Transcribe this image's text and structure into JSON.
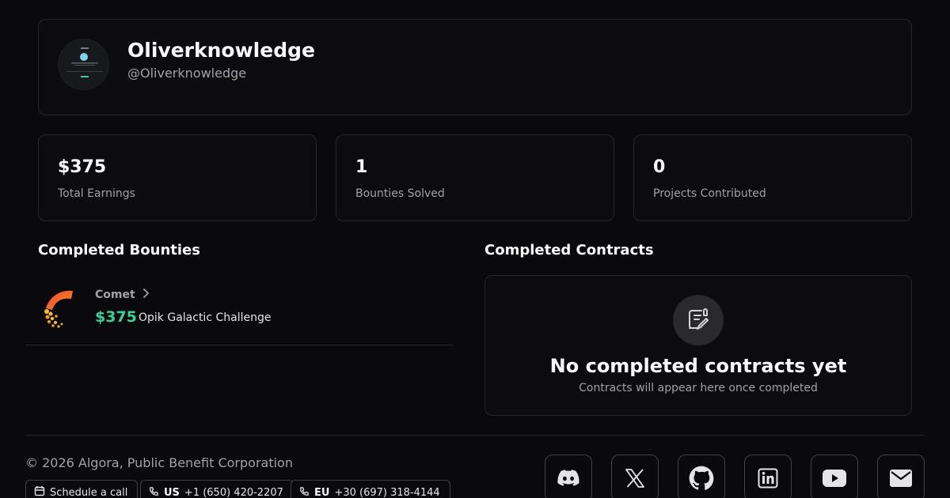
{
  "profile": {
    "name": "Oliverknowledge",
    "handle": "@Oliverknowledge"
  },
  "stats": [
    {
      "value": "$375",
      "label": "Total Earnings"
    },
    {
      "value": "1",
      "label": "Bounties Solved"
    },
    {
      "value": "0",
      "label": "Projects Contributed"
    }
  ],
  "bounties": {
    "title": "Completed Bounties",
    "items": [
      {
        "org": "Comet",
        "amount": "$375",
        "title": "Opik Galactic Challenge",
        "logo_icon": "comet-logo-icon"
      }
    ]
  },
  "contracts": {
    "title": "Completed Contracts",
    "empty_icon": "contract-edit-icon",
    "empty_title": "No completed contracts yet",
    "empty_subtitle": "Contracts will appear here once completed"
  },
  "footer": {
    "copyright": "© 2026 Algora, Public Benefit Corporation",
    "schedule_label": "Schedule a call",
    "phone_us_region": "US",
    "phone_us_number": "+1 (650) 420-2207",
    "phone_eu_region": "EU",
    "phone_eu_number": "+30 (697) 318-4144",
    "socials": [
      "discord-icon",
      "x-icon",
      "github-icon",
      "linkedin-icon",
      "youtube-icon",
      "mail-icon"
    ]
  },
  "colors": {
    "background": "#0a0a0c",
    "border": "#27272a",
    "accent_green": "#34d399",
    "muted_text": "#a1a1aa"
  }
}
